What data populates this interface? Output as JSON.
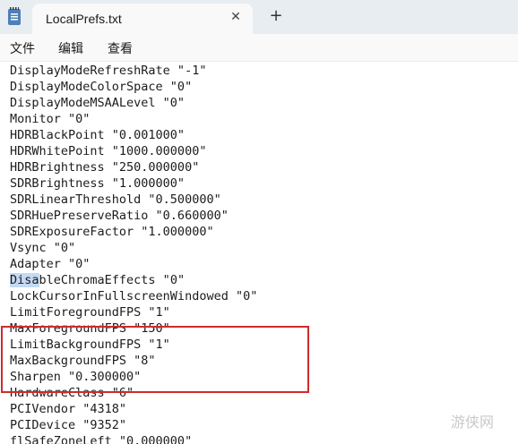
{
  "tab": {
    "title": "LocalPrefs.txt",
    "close_glyph": "✕",
    "new_tab_glyph": "+"
  },
  "menu": {
    "file": "文件",
    "edit": "编辑",
    "view": "查看"
  },
  "lines": [
    "DisplayModeRefreshRate \"-1\"",
    "DisplayModeColorSpace \"0\"",
    "DisplayModeMSAALevel \"0\"",
    "Monitor \"0\"",
    "HDRBlackPoint \"0.001000\"",
    "HDRWhitePoint \"1000.000000\"",
    "HDRBrightness \"250.000000\"",
    "SDRBrightness \"1.000000\"",
    "SDRLinearThreshold \"0.500000\"",
    "SDRHuePreserveRatio \"0.660000\"",
    "SDRExposureFactor \"1.000000\"",
    "Vsync \"0\"",
    "Adapter \"0\"",
    "DisableChromaEffects \"0\"",
    "LockCursorInFullscreenWindowed \"0\"",
    "LimitForegroundFPS \"1\"",
    "MaxForegroundFPS \"150\"",
    "LimitBackgroundFPS \"1\"",
    "MaxBackgroundFPS \"8\"",
    "Sharpen \"0.300000\"",
    "HardwareClass \"6\"",
    "PCIVendor \"4318\"",
    "PCIDevice \"9352\"",
    "flSafeZoneLeft \"0.000000\""
  ],
  "selection": {
    "line": 13,
    "text": "Disa"
  },
  "watermark": "游侠网",
  "colors": {
    "highlight_box": "#cf2a2a",
    "selection": "#c4d9f3"
  }
}
